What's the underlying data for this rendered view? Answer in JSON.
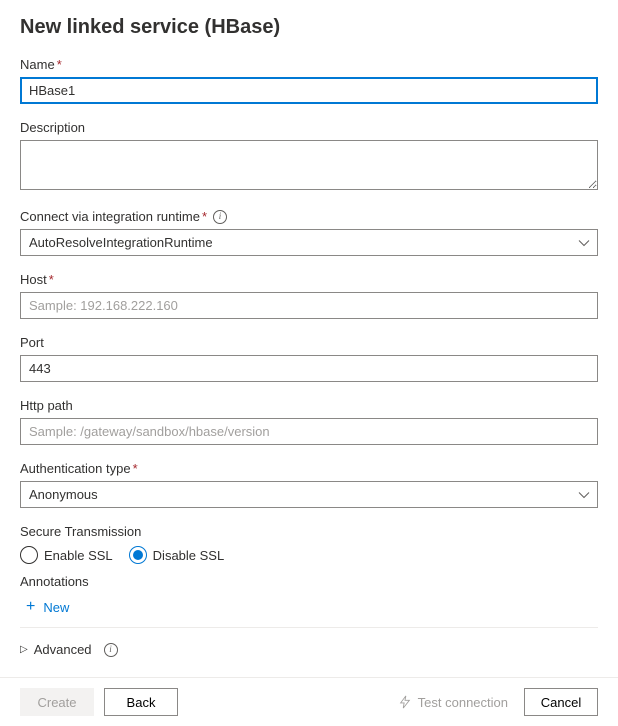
{
  "header": {
    "title": "New linked service (HBase)"
  },
  "fields": {
    "name": {
      "label": "Name",
      "value": "HBase1"
    },
    "description": {
      "label": "Description",
      "value": ""
    },
    "runtime": {
      "label": "Connect via integration runtime",
      "value": "AutoResolveIntegrationRuntime"
    },
    "host": {
      "label": "Host",
      "placeholder": "Sample: 192.168.222.160",
      "value": ""
    },
    "port": {
      "label": "Port",
      "value": "443"
    },
    "httpPath": {
      "label": "Http path",
      "placeholder": "Sample: /gateway/sandbox/hbase/version",
      "value": ""
    },
    "authType": {
      "label": "Authentication type",
      "value": "Anonymous"
    }
  },
  "secureTransmission": {
    "label": "Secure Transmission",
    "options": {
      "enable": "Enable SSL",
      "disable": "Disable SSL"
    },
    "selected": "disable"
  },
  "annotations": {
    "label": "Annotations",
    "newLabel": "New"
  },
  "advanced": {
    "label": "Advanced"
  },
  "footer": {
    "create": "Create",
    "back": "Back",
    "test": "Test connection",
    "cancel": "Cancel"
  }
}
